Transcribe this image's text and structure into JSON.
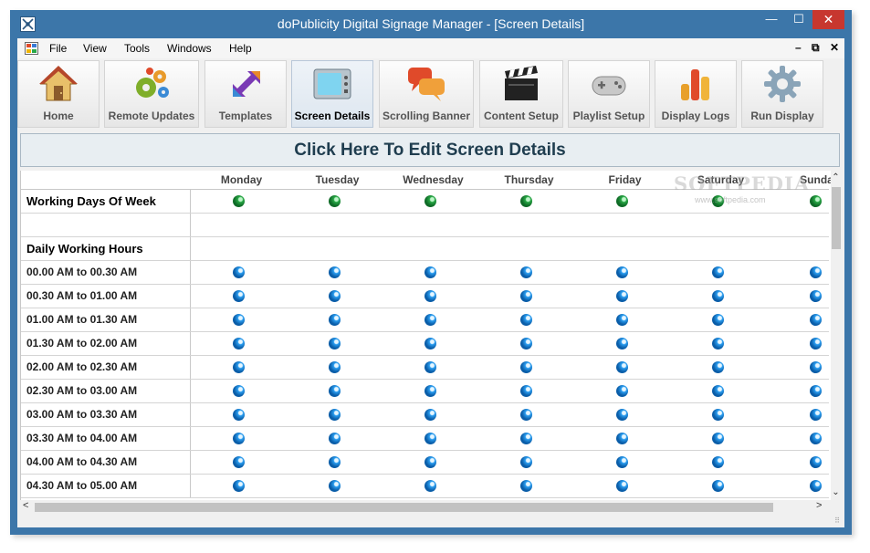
{
  "window": {
    "title": "doPublicity Digital Signage Manager - [Screen Details]",
    "minimize_glyph": "—",
    "maximize_glyph": "☐",
    "close_glyph": "✕"
  },
  "menu": {
    "items": [
      "File",
      "View",
      "Tools",
      "Windows",
      "Help"
    ],
    "mdi_minimize": "–",
    "mdi_restore": "⧉",
    "mdi_close": "✕"
  },
  "toolbar": {
    "buttons": [
      {
        "label": "Home",
        "icon": "home-icon"
      },
      {
        "label": "Remote Updates",
        "icon": "gears-icon"
      },
      {
        "label": "Templates",
        "icon": "arrows-icon"
      },
      {
        "label": "Screen Details",
        "icon": "tv-icon",
        "active": true
      },
      {
        "label": "Scrolling Banner",
        "icon": "speech-bubbles-icon"
      },
      {
        "label": "Content Setup",
        "icon": "clapperboard-icon"
      },
      {
        "label": "Playlist Setup",
        "icon": "gamepad-icon"
      },
      {
        "label": "Display Logs",
        "icon": "bar-chart-icon"
      },
      {
        "label": "Run Display",
        "icon": "gear-icon"
      }
    ]
  },
  "banner": {
    "label": "Click Here To Edit Screen Details"
  },
  "grid": {
    "days": [
      "Monday",
      "Tuesday",
      "Wednesday",
      "Thursday",
      "Friday",
      "Saturday",
      "Sunda"
    ],
    "working_days_label": "Working Days Of Week",
    "daily_hours_label": "Daily Working Hours",
    "time_slots": [
      "00.00 AM to 00.30 AM",
      "00.30 AM to 01.00 AM",
      "01.00 AM to 01.30 AM",
      "01.30 AM to 02.00 AM",
      "02.00 AM to 02.30 AM",
      "02.30 AM to 03.00 AM",
      "03.00 AM to 03.30 AM",
      "03.30 AM to 04.00 AM",
      "04.00 AM to 04.30 AM",
      "04.30 AM to 05.00 AM"
    ],
    "working_day_color": "#1f9a3a",
    "time_slot_color": "#1a86d8"
  },
  "watermark": {
    "text": "SOFTPEDIA",
    "sub": "www.softpedia.com"
  },
  "scrollbars": {
    "up": "⌃",
    "down": "⌄",
    "left": "<",
    "right": ">"
  },
  "status": {
    "grip": "⠿"
  }
}
